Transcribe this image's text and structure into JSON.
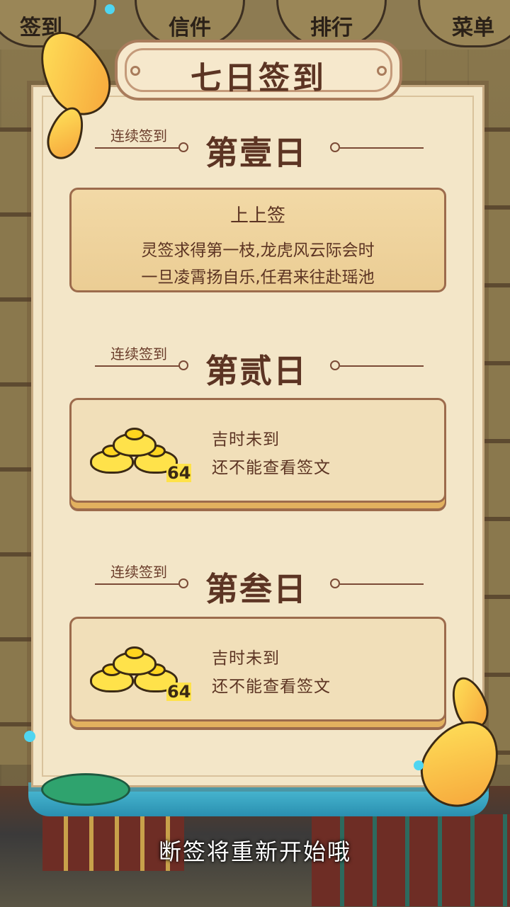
{
  "header": {
    "lanterns": [
      "签到",
      "信件",
      "排行",
      "菜单"
    ],
    "title": "七日签到"
  },
  "days": [
    {
      "streak_label": "连续签到",
      "day_label": "第壹日",
      "state": "unlocked",
      "fortune": {
        "title": "上上签",
        "line1": "灵签求得第一枝,龙虎风云际会时",
        "line2": "一旦凌霄扬自乐,任君来往赴瑶池"
      }
    },
    {
      "streak_label": "连续签到",
      "day_label": "第贰日",
      "state": "locked",
      "reward_icon": "gold-ingot-icon",
      "reward_count": "64",
      "locked_line1": "吉时未到",
      "locked_line2": "还不能查看签文"
    },
    {
      "streak_label": "连续签到",
      "day_label": "第叁日",
      "state": "locked",
      "reward_icon": "gold-ingot-icon",
      "reward_count": "64",
      "locked_line1": "吉时未到",
      "locked_line2": "还不能查看签文"
    }
  ],
  "footer": {
    "notice": "断签将重新开始哦"
  },
  "colors": {
    "panel": "#f3e6c8",
    "text_brown": "#5c3423",
    "gold": "#ffe24a",
    "water": "#4fc0d8"
  }
}
